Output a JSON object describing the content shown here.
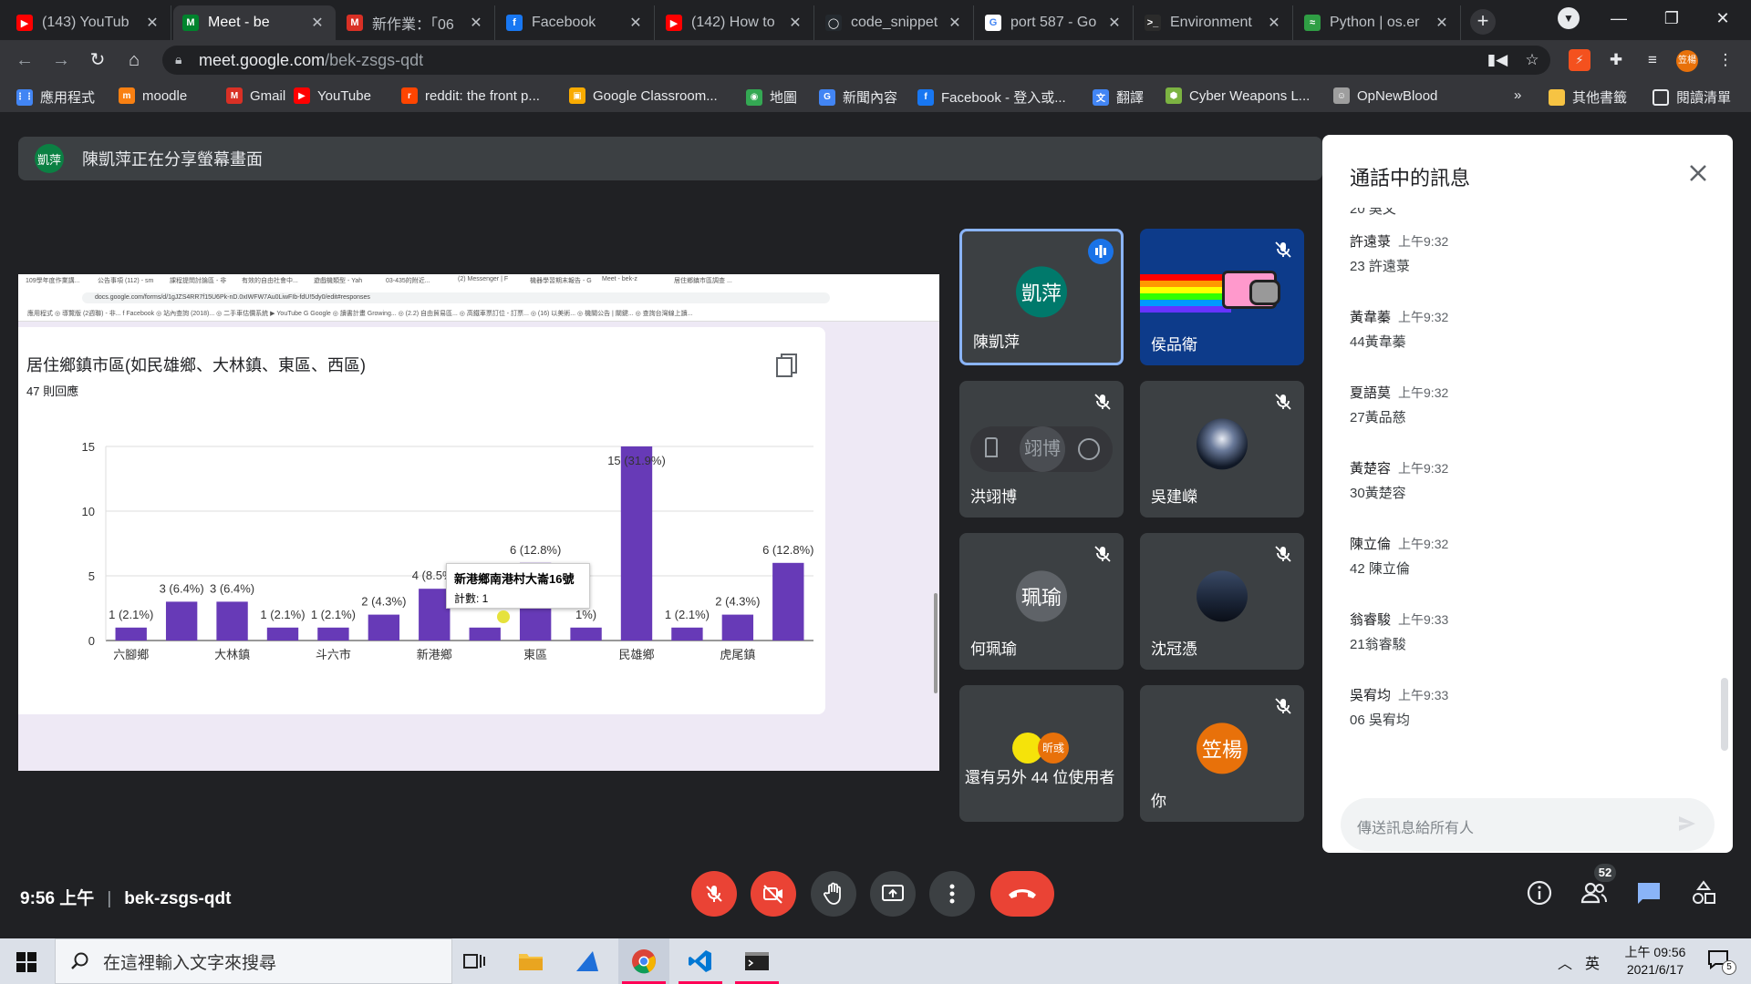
{
  "browser": {
    "tabs": [
      {
        "title": "(143) YouTub",
        "favicon_color": "#ff0000",
        "favicon": "▶"
      },
      {
        "title": "Meet - be",
        "favicon_color": "#00832d",
        "favicon": "M",
        "active": true
      },
      {
        "title": "新作業：「06",
        "favicon_color": "#d93025",
        "favicon": "M"
      },
      {
        "title": "Facebook",
        "favicon_color": "#1877f2",
        "favicon": "f"
      },
      {
        "title": "(142) How to",
        "favicon_color": "#ff0000",
        "favicon": "▶"
      },
      {
        "title": "code_snippet",
        "favicon_color": "#24292e",
        "favicon": "◯"
      },
      {
        "title": "port 587 - Go",
        "favicon_color": "#ffffff",
        "favicon": "G"
      },
      {
        "title": "Environment",
        "favicon_color": "#2b2b2b",
        "favicon": ">_"
      },
      {
        "title": "Python | os.er",
        "favicon_color": "#2f9e44",
        "favicon": "≈"
      }
    ],
    "tab_close": "✕",
    "new_tab": "+",
    "url_domain": "meet.google.com",
    "url_path": "/bek-zsgs-qdt",
    "profile_initials": "笠楊",
    "bookmarks": [
      {
        "label": "應用程式",
        "color": "#4285f4",
        "icon": "⋮⋮"
      },
      {
        "label": "moodle",
        "color": "#f98012",
        "icon": "m"
      },
      {
        "label": "Gmail",
        "color": "#d93025",
        "icon": "M"
      },
      {
        "label": "YouTube",
        "color": "#ff0000",
        "icon": "▶"
      },
      {
        "label": "reddit: the front p...",
        "color": "#ff4500",
        "icon": "r"
      },
      {
        "label": "Google Classroom...",
        "color": "#f9ab00",
        "icon": "▣"
      },
      {
        "label": "地圖",
        "color": "#34a853",
        "icon": "◉"
      },
      {
        "label": "新聞內容",
        "color": "#4285f4",
        "icon": "G"
      },
      {
        "label": "Facebook - 登入或...",
        "color": "#1877f2",
        "icon": "f"
      },
      {
        "label": "翻譯",
        "color": "#4285f4",
        "icon": "文"
      },
      {
        "label": "Cyber Weapons L...",
        "color": "#7cb342",
        "icon": "⬢"
      },
      {
        "label": "OpNewBlood",
        "color": "#9e9e9e",
        "icon": "☺"
      }
    ],
    "bookmarks_more": "»",
    "other_bookmarks": "其他書籤",
    "reading_list": "閱讀清單"
  },
  "meet": {
    "banner_avatar": "凱萍",
    "banner_text": "陳凱萍正在分享螢幕畫面",
    "shared_screen": {
      "mini_tabs": [
        "109學年度作業講...",
        "公告事項 (112) - sm",
        "課程提問討論區 - 非",
        "有效的自由社會中...",
        "遊戲機類型 - Yah",
        "03-435的附近...",
        "(2) Messenger | F",
        "機器學習期末報告 - G",
        "Meet - bek-z",
        "居住鄉鎮市區調查 ..."
      ],
      "mini_url": "docs.google.com/forms/d/1gJZS4RR7f15U6Pk-nD.0xIWFW7Au0LiwFIb-fdU!5dy0/edit#responses",
      "mini_bookmarks": "應用程式 ◎ 導覽版 (2週聯) - 非... f Facebook ◎ 站內查詢 (2018)... ◎ 二手車估價系統 ▶ YouTube G Google ◎ 讀書計畫 Growing... ◎ (2.2) 自由貿易區... ◎ 高鐵車票訂位 - 訂票... ◎ (16) 以美術... ◎ 機關公告 | 關鍵... ◎ 查詢台灣線上讀...",
      "question": "居住鄉鎮市區(如民雄鄉、大林鎮、東區、西區)",
      "responses": "47 則回應",
      "tooltip_title": "新港鄉南港村大崙16號",
      "tooltip_value": "計數: 1"
    },
    "participants": [
      {
        "name": "陳凱萍",
        "initials": "凱萍",
        "color": "#00796b",
        "speaking": true
      },
      {
        "name": "侯品衛",
        "image": "nyan"
      },
      {
        "name": "洪翊博",
        "initials": "翊博",
        "color": "#5f6368",
        "pinned_controls": true
      },
      {
        "name": "吳建嶸",
        "image": "photo"
      },
      {
        "name": "何珮瑜",
        "initials": "珮瑜",
        "color": "#5f6368"
      },
      {
        "name": "沈冠憑",
        "image": "night"
      },
      {
        "name": "還有另外 44 位使用者",
        "initials": "昕彧",
        "color": "#e8710a"
      },
      {
        "name": "你",
        "initials": "笠楊",
        "color": "#e8710a"
      }
    ],
    "chat": {
      "title": "通話中的訊息",
      "partial_top": "20 吳文",
      "messages": [
        {
          "sender": "許遠菉",
          "time": "上午9:32",
          "text": "23 許遠菉"
        },
        {
          "sender": "黃韋蓁",
          "time": "上午9:32",
          "text": "44黃韋蓁"
        },
        {
          "sender": "夏語莫",
          "time": "上午9:32",
          "text": "27黃品慈"
        },
        {
          "sender": "黃楚容",
          "time": "上午9:32",
          "text": "30黃楚容"
        },
        {
          "sender": "陳立倫",
          "time": "上午9:32",
          "text": "42 陳立倫"
        },
        {
          "sender": "翁睿駿",
          "time": "上午9:33",
          "text": "21翁睿駿"
        },
        {
          "sender": "吳宥均",
          "time": "上午9:33",
          "text": "06 吳宥均"
        }
      ],
      "input_placeholder": "傳送訊息給所有人"
    },
    "time": "9:56 上午",
    "divider": "|",
    "meeting_code": "bek-zsgs-qdt",
    "participant_count": "52"
  },
  "chart_data": {
    "type": "bar",
    "title": "居住鄉鎮市區(如民雄鄉、大林鎮、東區、西區)",
    "categories_labeled": [
      "六腳鄉",
      "大林鎮",
      "斗六市",
      "新港鄉",
      "東區",
      "民雄鄉",
      "虎尾鎮"
    ],
    "values": [
      1,
      3,
      3,
      1,
      1,
      2,
      4,
      1,
      6,
      1,
      15,
      1,
      2,
      6
    ],
    "labels": [
      "1 (2.1%)",
      "3 (6.4%)",
      "3 (6.4%)",
      "1 (2.1%)",
      "1 (2.1%)",
      "2 (4.3%)",
      "4 (8.5%)",
      "",
      "6 (12.8%)",
      "1%)",
      "15 (31.9%)",
      "1 (2.1%)",
      "2 (4.3%)",
      "6 (12.8%)"
    ],
    "y_ticks": [
      0,
      5,
      10,
      15
    ],
    "ylim": [
      0,
      15
    ],
    "bar_color": "#673ab7",
    "grid": true
  },
  "taskbar": {
    "search_placeholder": "在這裡輸入文字來搜尋",
    "ime": "英",
    "time": "上午 09:56",
    "date": "2021/6/17",
    "notif_count": "5"
  }
}
